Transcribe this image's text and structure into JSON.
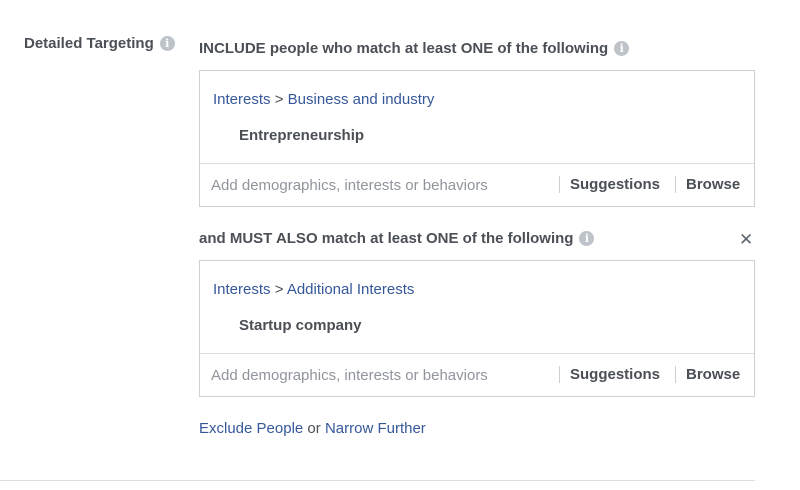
{
  "section_label": "Detailed Targeting",
  "include": {
    "heading": "INCLUDE people who match at least ONE of the following",
    "crumb_category": "Interests",
    "crumb_separator": ">",
    "crumb_subcategory": "Business and industry",
    "selected_item": "Entrepreneurship",
    "search_placeholder": "Add demographics, interests or behaviors",
    "suggestions_label": "Suggestions",
    "browse_label": "Browse"
  },
  "must_also": {
    "heading": "and MUST ALSO match at least ONE of the following",
    "crumb_category": "Interests",
    "crumb_separator": ">",
    "crumb_subcategory": "Additional Interests",
    "selected_item": "Startup company",
    "search_placeholder": "Add demographics, interests or behaviors",
    "suggestions_label": "Suggestions",
    "browse_label": "Browse",
    "close_glyph": "✕"
  },
  "footer_links": {
    "exclude_label": "Exclude People",
    "or_text": "or",
    "narrow_label": "Narrow Further"
  },
  "info_glyph": "i",
  "colors": {
    "link": "#365899",
    "text": "#4b4f56",
    "placeholder": "#90949c",
    "border": "#ced0d4",
    "info_icon_bg": "#bec2c9"
  }
}
